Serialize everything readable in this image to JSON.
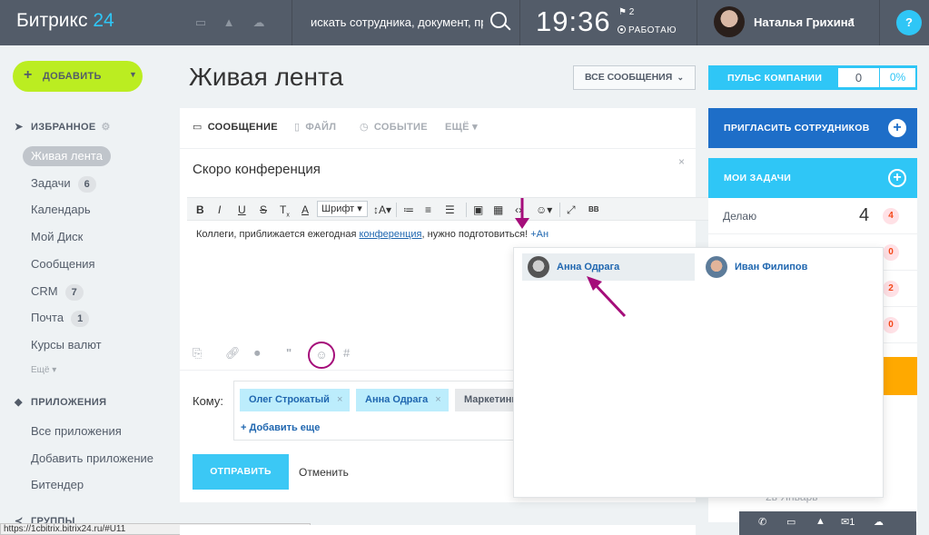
{
  "header": {
    "logo_main": "Битрикс",
    "logo_num": "24",
    "search_placeholder": "искать сотрудника, документ, пр",
    "clock": "19:36",
    "flag_count": "2",
    "status": "РАБОТАЮ",
    "user_name": "Наталья Грихина",
    "help": "?"
  },
  "sidebar": {
    "add_button": "ДОБАВИТЬ",
    "favorites_title": "ИЗБРАННОЕ",
    "favorites": [
      {
        "label": "Живая лента",
        "count": ""
      },
      {
        "label": "Задачи",
        "count": "6"
      },
      {
        "label": "Календарь",
        "count": ""
      },
      {
        "label": "Мой Диск",
        "count": ""
      },
      {
        "label": "Сообщения",
        "count": ""
      },
      {
        "label": "CRM",
        "count": "7"
      },
      {
        "label": "Почта",
        "count": "1"
      },
      {
        "label": "Курсы валют",
        "count": ""
      }
    ],
    "more": "Ещё",
    "apps_title": "ПРИЛОЖЕНИЯ",
    "apps": [
      "Все приложения",
      "Добавить приложение",
      "Битендер"
    ],
    "groups_title": "ГРУППЫ",
    "status_url": "https://1cbitrix.bitrix24.ru/#U11"
  },
  "main": {
    "page_title": "Живая лента",
    "filter": "ВСЕ СООБЩЕНИЯ",
    "tabs": [
      "СООБЩЕНИЕ",
      "ФАЙЛ",
      "СОБЫТИЕ",
      "ЕЩЁ"
    ],
    "post_title": "Скоро конференция",
    "toolbar": {
      "bold": "B",
      "italic": "I",
      "underline": "U",
      "strike": "S",
      "font": "Шрифт",
      "bb": "BB"
    },
    "text_before": "Коллеги, приближается ежегодная ",
    "text_link": "конференция",
    "text_after": ", нужно подготовиться! ",
    "text_mention": "+Ан",
    "to_label": "Кому:",
    "recipients": [
      "Олег Строкатый",
      "Анна Одрага",
      "Маркетинг"
    ],
    "add_more": "+ Добавить еще",
    "send": "ОТПРАВИТЬ",
    "cancel": "Отменить"
  },
  "mention_popup": {
    "people": [
      "Анна Одрага",
      "Иван Филипов"
    ]
  },
  "right": {
    "pulse_label": "ПУЛЬС КОМПАНИИ",
    "pulse_value": "0",
    "pulse_pct": "0%",
    "invite": "ПРИГЛАСИТЬ СОТРУДНИКОВ",
    "tasks_title": "МОИ ЗАДАЧИ",
    "tasks": [
      {
        "label": "Делаю",
        "num": "4",
        "badge": "4"
      },
      {
        "label": "",
        "num": "",
        "badge": "0"
      },
      {
        "label": "",
        "num": "",
        "badge": "2"
      },
      {
        "label": "",
        "num": "",
        "badge": "0"
      }
    ],
    "date_text": "2в Январь"
  },
  "colors": {
    "topbar": "#535c69",
    "accent": "#2fc6f6",
    "add_green": "#bbed21",
    "invite_blue": "#1e6ec8",
    "highlight_magenta": "#a50d7a"
  }
}
